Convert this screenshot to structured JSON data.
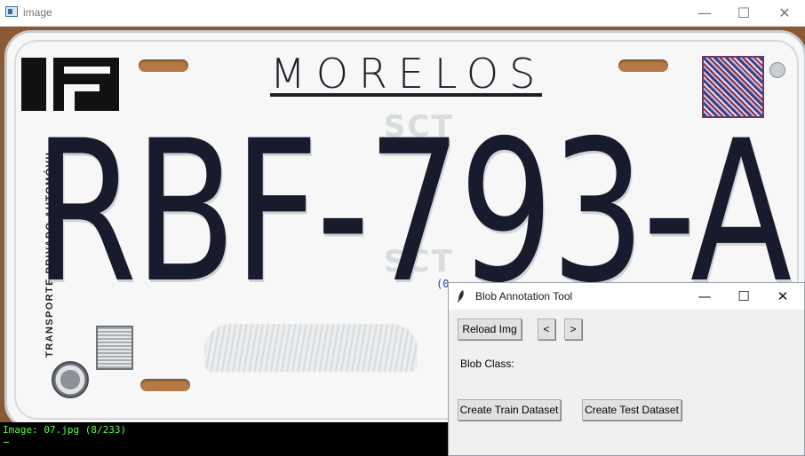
{
  "main_window": {
    "title": "image",
    "controls": {
      "minimize": "—",
      "maximize": "☐",
      "close": "✕"
    }
  },
  "plate": {
    "state": "MORELOS",
    "number": "RBF-793-A",
    "side_text": "TRANSPORTE PRIVADO AUTOMÓVIL",
    "watermark_top": "SCT",
    "watermark_bottom": "SCT",
    "blob_marker": "(0"
  },
  "status_bar": {
    "text": "Image: 07.jpg (8/233)"
  },
  "tool_window": {
    "title": "Blob Annotation Tool",
    "controls": {
      "minimize": "—",
      "maximize": "☐",
      "close": "✕"
    },
    "reload_label": "Reload Img",
    "prev_label": "<",
    "next_label": ">",
    "blob_class_label": "Blob Class:",
    "train_label": "Create Train Dataset",
    "test_label": "Create Test Dataset"
  },
  "colors": {
    "status_text": "#5cff4c",
    "plate_text": "#171b2c",
    "frame": "#8a5a37"
  }
}
